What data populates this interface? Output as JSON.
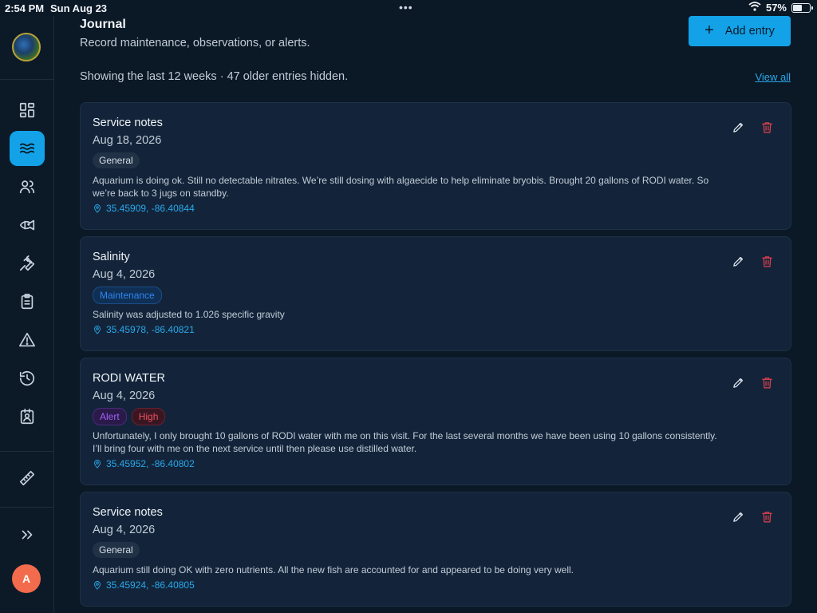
{
  "status_bar": {
    "time": "2:54 PM",
    "date": "Sun Aug 23",
    "multitask_dots": "•••",
    "wifi_icon": "wifi-icon",
    "battery_percent": "57%",
    "battery_level": 0.57
  },
  "sidebar": {
    "brand_avatar_icon": "brand-logo-icon",
    "items": [
      {
        "name": "dashboard",
        "icon": "grid-icon",
        "active": false
      },
      {
        "name": "journal",
        "icon": "waves-icon",
        "active": true
      },
      {
        "name": "people",
        "icon": "users-icon",
        "active": false
      },
      {
        "name": "livestock",
        "icon": "fish-icon",
        "active": false
      },
      {
        "name": "maintenance",
        "icon": "wrench-icon",
        "active": false
      },
      {
        "name": "checklist",
        "icon": "clipboard-icon",
        "active": false
      },
      {
        "name": "alerts",
        "icon": "warning-icon",
        "active": false
      },
      {
        "name": "history",
        "icon": "history-icon",
        "active": false
      },
      {
        "name": "contacts",
        "icon": "id-badge-icon",
        "active": false
      },
      {
        "name": "measure",
        "icon": "ruler-icon",
        "active": false
      }
    ],
    "expand_icon": "chevrons-right-icon",
    "user_initial": "A"
  },
  "header": {
    "title": "Journal",
    "subtitle": "Record maintenance, observations, or alerts.",
    "add_button_label": "Add entry",
    "add_button_icon": "plus-icon",
    "plus_glyph": "+"
  },
  "filter": {
    "info": "Showing the last 12 weeks · 47 older entries hidden.",
    "view_all_label": "View all"
  },
  "entries": [
    {
      "title": "Service notes",
      "date": "Aug 18, 2026",
      "tags": [
        {
          "label": "General",
          "kind": "general"
        }
      ],
      "body": "Aquarium is doing ok. Still no detectable nitrates. We’re still dosing with algaecide to help eliminate bryobis. Brought 20 gallons of RODI water. So we’re back to 3 jugs on standby.",
      "location": "35.45909, -86.40844"
    },
    {
      "title": "Salinity",
      "date": "Aug 4, 2026",
      "tags": [
        {
          "label": "Maintenance",
          "kind": "maintenance"
        }
      ],
      "body": "Salinity was adjusted to 1.026 specific gravity",
      "location": "35.45978, -86.40821"
    },
    {
      "title": "RODI WATER",
      "date": "Aug 4, 2026",
      "tags": [
        {
          "label": "Alert",
          "kind": "alert"
        },
        {
          "label": "High",
          "kind": "high"
        }
      ],
      "body": "Unfortunately, I only brought 10 gallons of RODI water with me on this visit. For the last several months we have been using 10 gallons consistently. I’ll bring four with me on the next service until then please use distilled water.",
      "location": "35.45952, -86.40802"
    },
    {
      "title": "Service notes",
      "date": "Aug 4, 2026",
      "tags": [
        {
          "label": "General",
          "kind": "general"
        }
      ],
      "body": "Aquarium still doing OK with zero nutrients. All the new fish are accounted for and appeared to be doing very well.",
      "location": "35.45924, -86.40805"
    }
  ],
  "colors": {
    "background": "#0b1826",
    "card": "#13243a",
    "accent": "#13a2e8",
    "link": "#28a8ea",
    "danger": "#e0404c",
    "avatar": "#f26b4c"
  }
}
